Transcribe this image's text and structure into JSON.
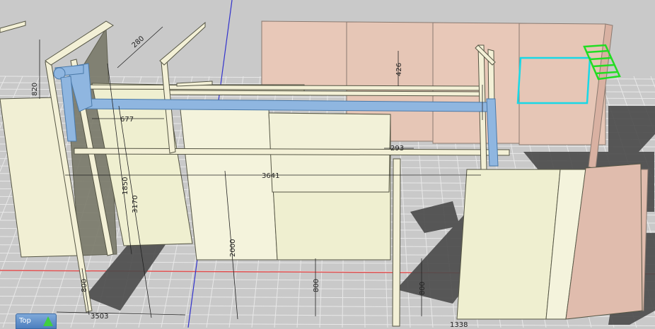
{
  "scene": {
    "colors": {
      "background": "#c9c9c9",
      "grid": "#e8e8e8",
      "shadow": "#4a4a4a",
      "board": "#efefd0",
      "board_light": "#f4f3dc",
      "board_edge": "#555544",
      "frame": "#f3f0d6",
      "pipe": "#8fb6e0",
      "pink_panel": "#e8c8b8",
      "cyan_selection": "#19d8e6",
      "green_selection": "#22dd22",
      "axis_red": "#e05050",
      "axis_blue": "#3333cc"
    }
  },
  "dimensions": {
    "d820": "820",
    "d677": "677",
    "d1850": "1850",
    "d3170": "3170",
    "d3641": "3641",
    "d2000": "2000",
    "d800_left": "800",
    "d800_mid": "800",
    "d800_right": "800",
    "d3503": "3503",
    "d426": "426",
    "d293": "293",
    "d1338": "1338",
    "d280": "280"
  },
  "view_widget": {
    "label": "Top",
    "icon": "navigation-cube-icon"
  }
}
